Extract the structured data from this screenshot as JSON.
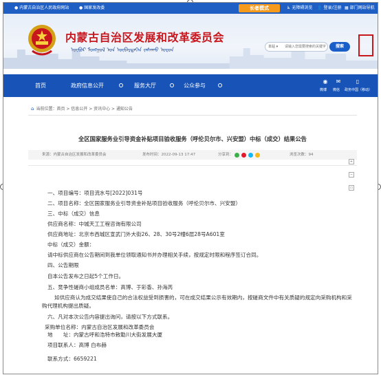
{
  "topbar": {
    "left_link_1": "内蒙古自治区人民政府网站",
    "left_link_2": "国家发改委",
    "elder_mode": "长者模式",
    "accessibility": "无障碍浏览",
    "login": "登录/注册",
    "dept_portal": "部门网站导航"
  },
  "header": {
    "site_title": "内蒙古自治区发展和改革委员会",
    "site_subtitle": "ᠥᠪᠥᠷ ᠮᠣᠩᠭᠣᠯ ᠤᠨ ᠥᠪᠡᠷᠲᠡᠭᠡᠨ ᠵᠠᠰᠠᠬᠤ ᠣᠷᠤᠨ",
    "search_scope": "本站 ▾",
    "search_placeholder": "请输入您需要搜索的关键字",
    "search_button": "搜索",
    "seal_text": "発改"
  },
  "nav": {
    "items": [
      "首页",
      "政府信息公开",
      "服务大厅",
      "公众参与"
    ],
    "icons": [
      "微博",
      "微信",
      "政务中国（移动）"
    ]
  },
  "breadcrumb": {
    "label": "当前位置：首页 > 信息公开 > 资讯中心 > 通知公告"
  },
  "article": {
    "title": "全区国家服务业引导资金补贴项目验收服务（呼伦贝尔市、兴安盟）中标（成交）结果公告",
    "source": "来源：内蒙古自治区发展和改革委员会",
    "publish_time": "发布时间：2022-09-13 17:47",
    "share": "分享到：",
    "views": "浏览次数：94",
    "lines": [
      "一、项目编号：项目流水号[2022]031号",
      "二、项目名称：全区国家服务业引导资金补贴项目验收服务（呼伦贝尔市、兴安盟）",
      "三、中标（成交）信息",
      "供应商名称：中城天工工程咨询有限公司",
      "供应商地址：北京市西城区宣武门外大街26、28、30号2幢6层28号A601室",
      "中标（成交）金额：",
      "请中标供应商在公告期间到我单位领取通知书并办理相关手续，按规定时限和程序签订合同。",
      "四、公告期限",
      "自本公告发布之日起5个工作日。",
      "五、竞争性磋商小组成员名单：高博、于彩香、孙海芮",
      "如供应商认为成交结果使自己的合法权益受到损害的，可在成交结果公示有效期内，按磋商文件中有关质疑的规定向采购机构和采购代理机构提出质疑。",
      "六、凡对本次公告内容提出询问，请按以下方式联系。",
      "采购单位名称：内蒙古自治区发展和改革委员会",
      "地　　址：内蒙古呼和浩特市敕勒川大街发展大厦",
      "项目联系人：高博  白布赫",
      "联系方式：6659221"
    ]
  },
  "colors": {
    "topbar": "#1f5ec2",
    "nav": "#1854b8",
    "title_red": "#c8161d",
    "elder_orange": "#f59a1b"
  }
}
